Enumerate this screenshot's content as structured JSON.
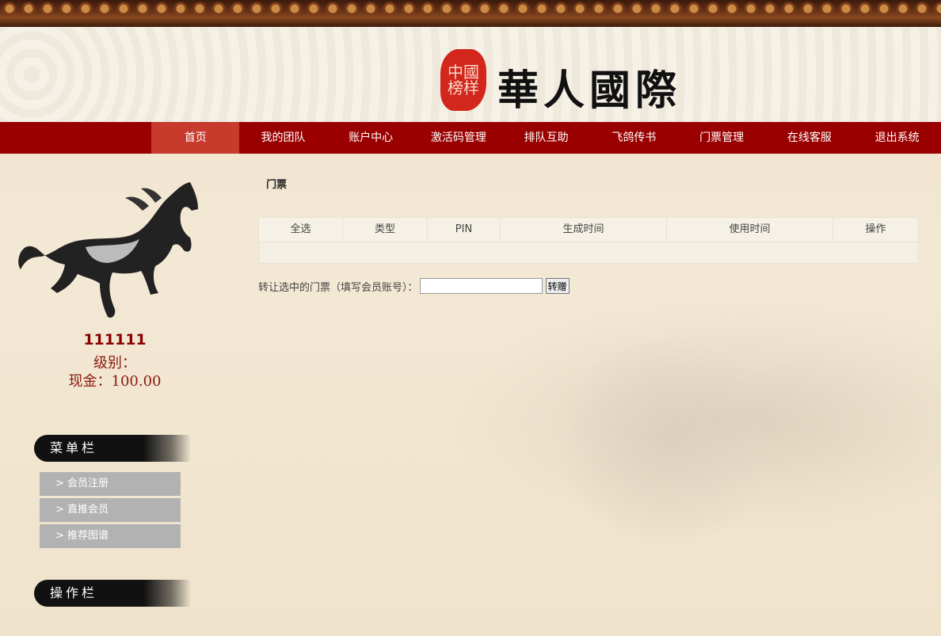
{
  "header": {
    "logo_seal": "中國榜样",
    "site_title": "華人國際"
  },
  "nav": {
    "items": [
      {
        "label": "首页",
        "active": true
      },
      {
        "label": "我的团队"
      },
      {
        "label": "账户中心"
      },
      {
        "label": "激活码管理"
      },
      {
        "label": "排队互助"
      },
      {
        "label": "飞鸽传书"
      },
      {
        "label": "门票管理"
      },
      {
        "label": "在线客服"
      },
      {
        "label": "退出系统"
      }
    ]
  },
  "profile": {
    "username": "111111",
    "level": "级别：",
    "cash": "现金：100.00"
  },
  "sidebar": {
    "menu_title": "菜单栏",
    "menu_items": [
      {
        "label": ">  会员注册"
      },
      {
        "label": ">  直推会员"
      },
      {
        "label": ">  推荐图谱"
      }
    ],
    "ops_title": "操作栏"
  },
  "main": {
    "breadcrumb": "门票",
    "table": {
      "columns": [
        "全选",
        "类型",
        "PIN",
        "生成时间",
        "使用时间",
        "操作"
      ],
      "rows": []
    },
    "transfer": {
      "label": "转让选中的门票（填写会员账号）：",
      "input_value": "",
      "button_label": "转赠"
    }
  },
  "colors": {
    "nav_bg": "#9b0000",
    "nav_active": "#c83a2c",
    "accent_text": "#8b0000",
    "menu_item_bg": "#b2b2b2"
  }
}
